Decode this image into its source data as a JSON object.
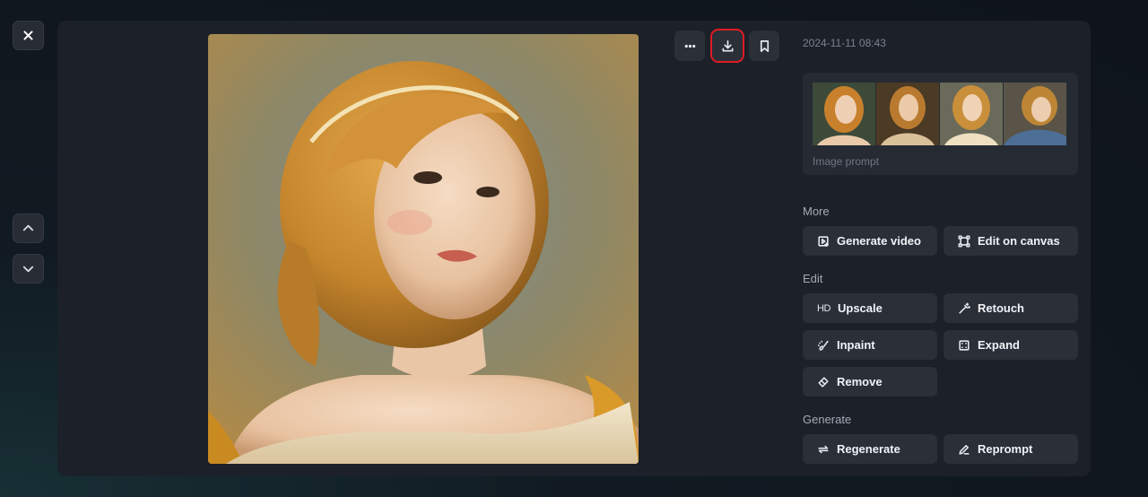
{
  "nav": {
    "close_icon": "close-icon",
    "up_icon": "chevron-up-icon",
    "down_icon": "chevron-down-icon"
  },
  "toolbar": {
    "more_icon": "more-horizontal-icon",
    "download_icon": "download-icon",
    "bookmark_icon": "bookmark-icon",
    "highlight_color": "#e01b24"
  },
  "details": {
    "timestamp": "2024-11-11 08:43",
    "prompt_label": "Image prompt"
  },
  "sections": {
    "more": {
      "title": "More",
      "buttons": [
        {
          "label": "Generate video",
          "icon": "video-plus-icon"
        },
        {
          "label": "Edit on canvas",
          "icon": "canvas-icon"
        }
      ]
    },
    "edit": {
      "title": "Edit",
      "buttons": [
        {
          "label": "Upscale",
          "icon": "hd-icon",
          "glyph": "HD"
        },
        {
          "label": "Retouch",
          "icon": "magic-wand-icon"
        },
        {
          "label": "Inpaint",
          "icon": "inpaint-brush-icon"
        },
        {
          "label": "Expand",
          "icon": "expand-icon"
        },
        {
          "label": "Remove",
          "icon": "eraser-icon"
        }
      ]
    },
    "generate": {
      "title": "Generate",
      "buttons": [
        {
          "label": "Regenerate",
          "icon": "regenerate-icon"
        },
        {
          "label": "Reprompt",
          "icon": "pencil-icon"
        }
      ]
    }
  }
}
